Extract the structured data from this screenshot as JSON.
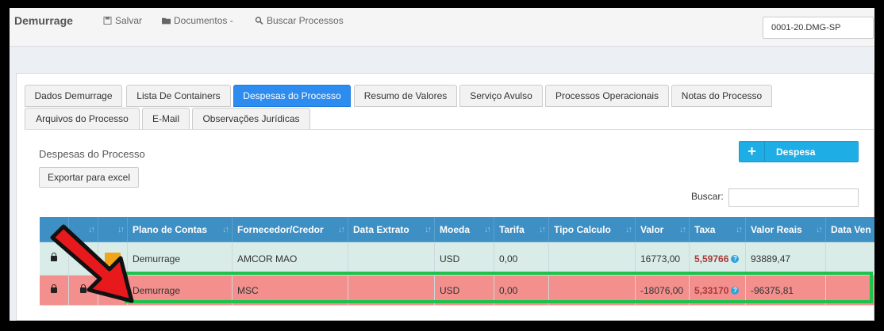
{
  "app": {
    "title": "Demurrage"
  },
  "topbar": {
    "save_label": "Salvar",
    "documents_label": "Documentos -",
    "search_label": "Buscar Processos",
    "process_selected": "0001-20.DMG-SP"
  },
  "tabs": [
    {
      "label": "Dados Demurrage"
    },
    {
      "label": "Lista De Containers"
    },
    {
      "label": "Despesas do Processo"
    },
    {
      "label": "Resumo de Valores"
    },
    {
      "label": "Serviço Avulso"
    },
    {
      "label": "Processos Operacionais"
    },
    {
      "label": "Notas do Processo"
    },
    {
      "label": "Arquivos do Processo"
    },
    {
      "label": "E-Mail"
    },
    {
      "label": "Observações Jurídicas"
    }
  ],
  "section": {
    "title": "Despesas do Processo",
    "add_button": "Despesa",
    "export_button": "Exportar para excel",
    "search_label": "Buscar:",
    "search_value": ""
  },
  "table": {
    "columns": [
      "Plano de Contas",
      "Fornecedor/Credor",
      "Data Extrato",
      "Moeda",
      "Tarifa",
      "Tipo Calculo",
      "Valor",
      "Taxa",
      "Valor Reais",
      "Data Ven"
    ],
    "rows": [
      {
        "plano": "Demurrage",
        "fornecedor": "AMCOR MAO",
        "data_extrato": "",
        "moeda": "USD",
        "tarifa": "0,00",
        "tipo_calculo": "",
        "valor": "16773,00",
        "taxa": "5,59766",
        "valor_reais": "93889,47",
        "data_ven": ""
      },
      {
        "plano": "Demurrage",
        "fornecedor": "MSC",
        "data_extrato": "",
        "moeda": "USD",
        "tarifa": "0,00",
        "tipo_calculo": "",
        "valor": "-18076,00",
        "taxa": "5,33170",
        "valor_reais": "-96375,81",
        "data_ven": ""
      }
    ]
  },
  "colors": {
    "accent": "#2d8cf0",
    "header": "#3d8fc4",
    "row_ok": "#d9ece8",
    "row_alert": "#f38f8c",
    "highlight": "#1fc24a",
    "arrow": "#e8191c"
  },
  "icons": [
    "save-icon",
    "folder-icon",
    "search-icon",
    "plus-icon",
    "lock-icon",
    "edit-icon",
    "help-icon",
    "sort-icon"
  ]
}
